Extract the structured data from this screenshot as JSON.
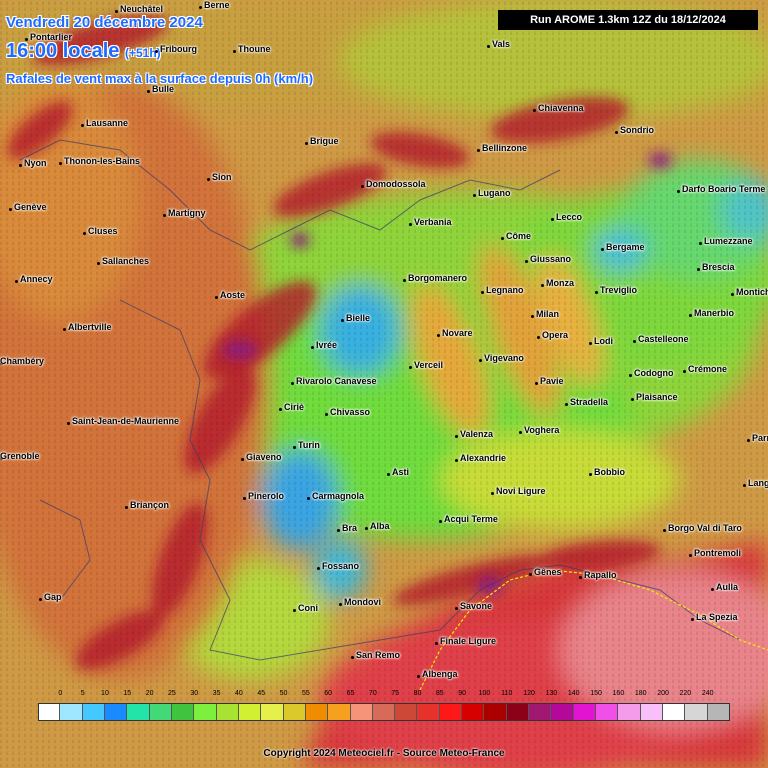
{
  "header": {
    "date": "Vendredi 20 décembre 2024",
    "time": "16:00 locale",
    "offset": "(+51h)",
    "parameter": "Rafales de vent max à la surface depuis 0h (km/h)"
  },
  "run_info": "Run AROME 1.3km 12Z du 18/12/2024",
  "footer": {
    "copyright": "Copyright 2024 Meteociel.fr - Source Meteo-France"
  },
  "colors": {
    "low_lake": "#2ea0e6",
    "plain_green": "#7ddc3a",
    "yellow_green": "#c6e03a",
    "orange": "#e49a3a",
    "ridge_red": "#c0202a",
    "sea_red": "#d8323a",
    "violet": "#9a1e8a"
  },
  "legend": {
    "ticks": [
      "0",
      "5",
      "10",
      "15",
      "20",
      "25",
      "30",
      "35",
      "40",
      "45",
      "50",
      "55",
      "60",
      "65",
      "70",
      "75",
      "80",
      "85",
      "90",
      "100",
      "110",
      "120",
      "130",
      "140",
      "150",
      "160",
      "180",
      "200",
      "220",
      "240"
    ],
    "colors": [
      "#ffffff",
      "#9fe6ff",
      "#44c8ff",
      "#1a8aff",
      "#22e3a8",
      "#44d978",
      "#40c440",
      "#7cf03c",
      "#a8e232",
      "#d2f032",
      "#e6f04a",
      "#dbc82a",
      "#f08c00",
      "#f6a020",
      "#f59478",
      "#d86a5a",
      "#ce4838",
      "#e6322a",
      "#ff1818",
      "#d60000",
      "#aa0000",
      "#8c0018",
      "#a01870",
      "#b4089a",
      "#e214d2",
      "#f050e8",
      "#f49cea",
      "#f8c0f8",
      "#ffffff",
      "#d6d6d6",
      "#b6b6b6"
    ]
  },
  "cities": [
    {
      "name": "Neuchâtel"
    },
    {
      "name": "Berne"
    },
    {
      "name": "Pontarlier"
    },
    {
      "name": "Fribourg"
    },
    {
      "name": "Thoune"
    },
    {
      "name": "Bulle"
    },
    {
      "name": "Lausanne"
    },
    {
      "name": "Nyon"
    },
    {
      "name": "Thonon-les-Bains"
    },
    {
      "name": "Sion"
    },
    {
      "name": "Brigue"
    },
    {
      "name": "Genève"
    },
    {
      "name": "Martigny"
    },
    {
      "name": "Cluses"
    },
    {
      "name": "Sallanches"
    },
    {
      "name": "Annecy"
    },
    {
      "name": "Aoste"
    },
    {
      "name": "Albertville"
    },
    {
      "name": "Chambéry"
    },
    {
      "name": "Saint-Jean-de-Maurienne"
    },
    {
      "name": "Ivrée"
    },
    {
      "name": "Rivarolo Canavese"
    },
    {
      "name": "Ciriè"
    },
    {
      "name": "Chivasso"
    },
    {
      "name": "Turin"
    },
    {
      "name": "Giaveno"
    },
    {
      "name": "Pinerolo"
    },
    {
      "name": "Carmagnola"
    },
    {
      "name": "Briançon"
    },
    {
      "name": "Gap"
    },
    {
      "name": "Bra"
    },
    {
      "name": "Alba"
    },
    {
      "name": "Asti"
    },
    {
      "name": "Fossano"
    },
    {
      "name": "Coni"
    },
    {
      "name": "Mondovì"
    },
    {
      "name": "San Remo"
    },
    {
      "name": "Albenga"
    },
    {
      "name": "Finale Ligure"
    },
    {
      "name": "Savone"
    },
    {
      "name": "Gênes"
    },
    {
      "name": "Rapallo"
    },
    {
      "name": "La Spezia"
    },
    {
      "name": "Aulla"
    },
    {
      "name": "Pontremoli"
    },
    {
      "name": "Borgo Val di Taro"
    },
    {
      "name": "Bobbio"
    },
    {
      "name": "Novi Ligure"
    },
    {
      "name": "Acqui Terme"
    },
    {
      "name": "Alexandrie"
    },
    {
      "name": "Valenza"
    },
    {
      "name": "Voghera"
    },
    {
      "name": "Stradella"
    },
    {
      "name": "Pavie"
    },
    {
      "name": "Vigevano"
    },
    {
      "name": "Verceil"
    },
    {
      "name": "Novare"
    },
    {
      "name": "Bielle"
    },
    {
      "name": "Borgomanero"
    },
    {
      "name": "Verbania"
    },
    {
      "name": "Domodossola"
    },
    {
      "name": "Legnano"
    },
    {
      "name": "Milan"
    },
    {
      "name": "Opera"
    },
    {
      "name": "Monza"
    },
    {
      "name": "Giussano"
    },
    {
      "name": "Côme"
    },
    {
      "name": "Lecco"
    },
    {
      "name": "Lugano"
    },
    {
      "name": "Bellinzone"
    },
    {
      "name": "Vals"
    },
    {
      "name": "Chiavenna"
    },
    {
      "name": "Sondrio"
    },
    {
      "name": "Darfo Boario Terme"
    },
    {
      "name": "Bergame"
    },
    {
      "name": "Lumezzane"
    },
    {
      "name": "Brescia"
    },
    {
      "name": "Treviglio"
    },
    {
      "name": "Lodi"
    },
    {
      "name": "Castelleone"
    },
    {
      "name": "Manerbio"
    },
    {
      "name": "Montichiari"
    },
    {
      "name": "Crémone"
    },
    {
      "name": "Codogno"
    },
    {
      "name": "Plaisance"
    },
    {
      "name": "Parme"
    },
    {
      "name": "Langhirano"
    },
    {
      "name": "Grenoble"
    }
  ]
}
